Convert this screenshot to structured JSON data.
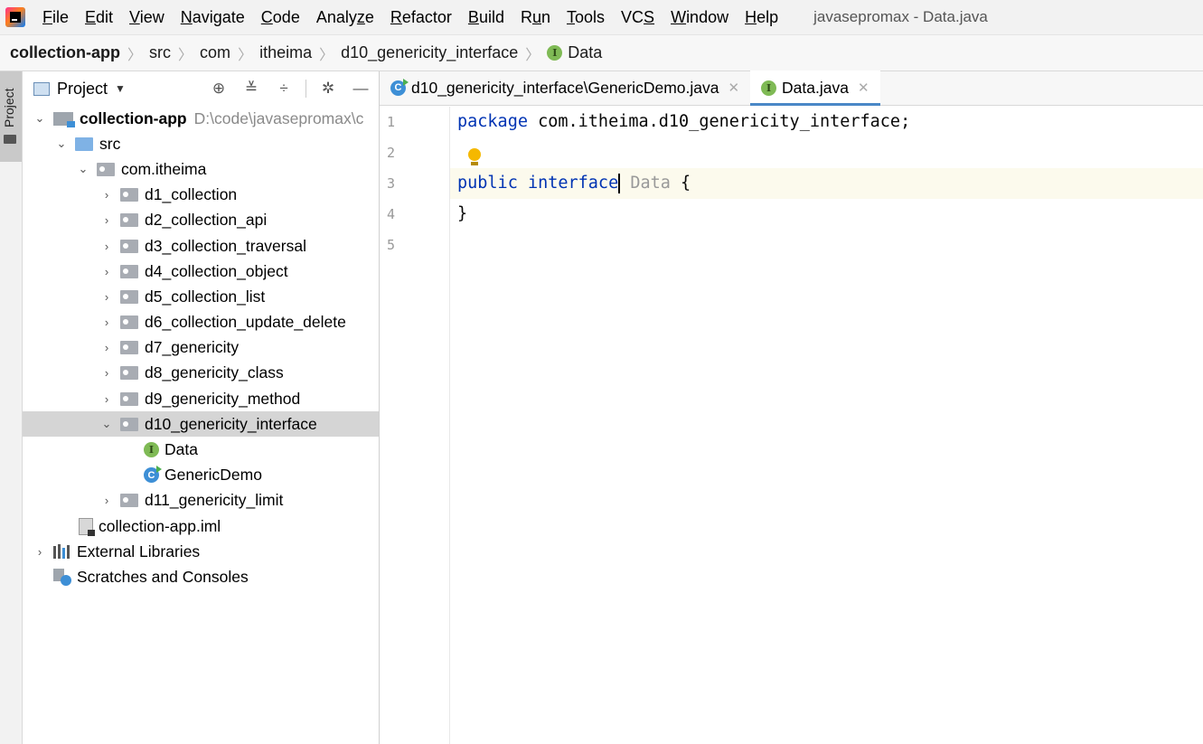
{
  "menu": {
    "items": [
      {
        "underline": "F",
        "rest": "ile"
      },
      {
        "underline": "E",
        "rest": "dit"
      },
      {
        "underline": "V",
        "rest": "iew"
      },
      {
        "underline": "N",
        "rest": "avigate"
      },
      {
        "underline": "C",
        "rest": "ode"
      },
      {
        "pre": "Analy",
        "underline": "z",
        "rest": "e"
      },
      {
        "underline": "R",
        "rest": "efactor"
      },
      {
        "underline": "B",
        "rest": "uild"
      },
      {
        "pre": "R",
        "underline": "u",
        "rest": "n"
      },
      {
        "underline": "T",
        "rest": "ools"
      },
      {
        "pre": "VC",
        "underline": "S",
        "rest": ""
      },
      {
        "underline": "W",
        "rest": "indow"
      },
      {
        "underline": "H",
        "rest": "elp"
      }
    ],
    "window_title": "javasepromax - Data.java"
  },
  "breadcrumb": {
    "items": [
      "collection-app",
      "src",
      "com",
      "itheima",
      "d10_genericity_interface",
      "Data"
    ],
    "interface_badge": "I"
  },
  "tool_stripe": {
    "project_label": "Project"
  },
  "project_panel": {
    "title": "Project",
    "tree": {
      "root": {
        "label": "collection-app",
        "path": "D:\\code\\javasepromax\\c"
      },
      "src": "src",
      "package": "com.itheima",
      "folders": [
        "d1_collection",
        "d2_collection_api",
        "d3_collection_traversal",
        "d4_collection_object",
        "d5_collection_list",
        "d6_collection_update_delete",
        "d7_genericity",
        "d8_genericity_class",
        "d9_genericity_method",
        "d10_genericity_interface"
      ],
      "children": [
        "Data",
        "GenericDemo"
      ],
      "last_folder": "d11_genericity_limit",
      "iml": "collection-app.iml",
      "external_libraries": "External Libraries",
      "scratches": "Scratches and Consoles"
    }
  },
  "editor": {
    "tabs": [
      {
        "label": "d10_genericity_interface\\GenericDemo.java",
        "badge": "C"
      },
      {
        "label": "Data.java",
        "badge": "I"
      }
    ],
    "line_numbers": [
      "1",
      "2",
      "3",
      "4",
      "5"
    ],
    "code": {
      "line1_kw": "package",
      "line1_rest": " com.itheima.d10_genericity_interface;",
      "line3_kw1": "public",
      "line3_kw2": "interface",
      "line3_type": "Data",
      "line3_brace": " {",
      "line4": "}"
    }
  },
  "colors": {
    "keyword": "#0033b3",
    "current_line": "#fcfaed",
    "selection": "#d5d5d5",
    "tab_underline": "#4a88c7"
  }
}
